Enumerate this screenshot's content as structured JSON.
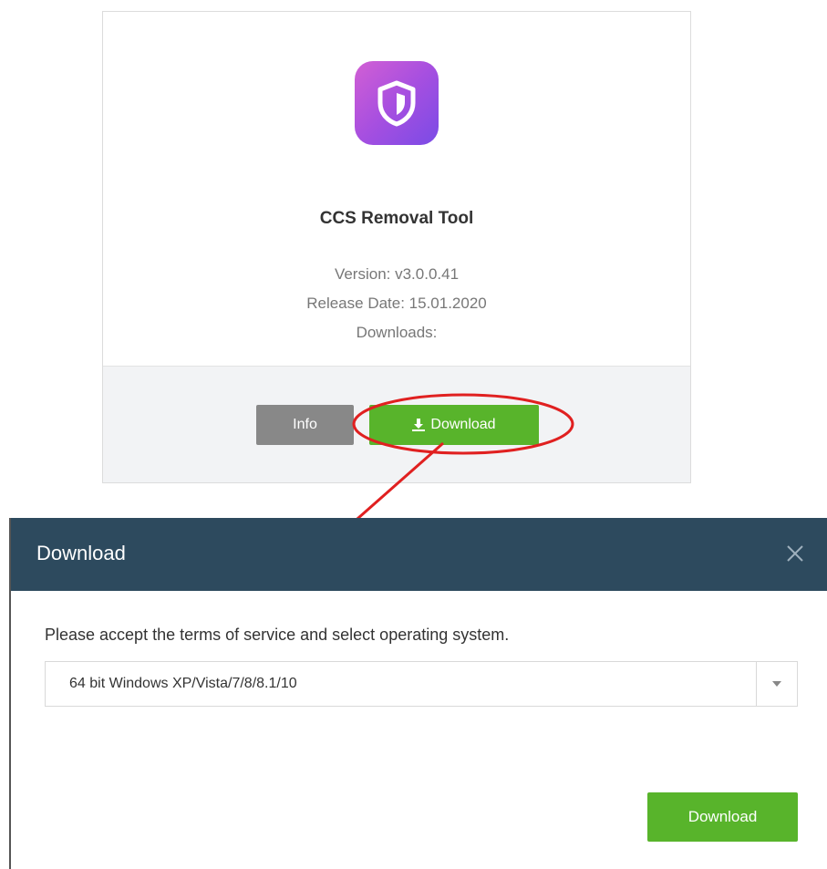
{
  "product_card": {
    "icon": "shield-icon",
    "icon_gradient": [
      "#d25fd4",
      "#7a4be6"
    ],
    "name": "CCS Removal Tool",
    "version": "Version: v3.0.0.41",
    "release_date": "Release Date: 15.01.2020",
    "downloads": "Downloads:",
    "info_button": "Info",
    "download_button": "Download",
    "download_icon": "download-icon"
  },
  "annotation": {
    "color": "#e02020"
  },
  "modal": {
    "title": "Download",
    "close_icon": "close-icon",
    "header_color": "#2d4a5e",
    "message": "Please accept the terms of service and select operating system.",
    "os_select": {
      "selected": "64 bit Windows XP/Vista/7/8/8.1/10",
      "arrow_icon": "caret-down-icon"
    },
    "download_button": "Download",
    "button_color": "#58b42b"
  }
}
